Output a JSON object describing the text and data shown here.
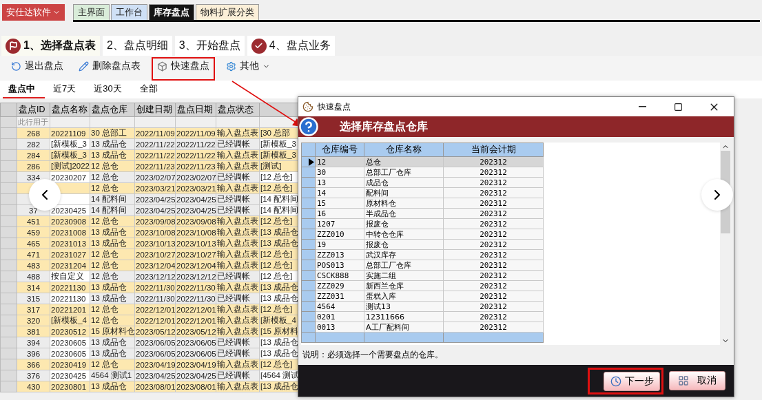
{
  "app_menu": {
    "label": "安仕达软件"
  },
  "main_tabs": [
    {
      "label": "主界面",
      "selected": false,
      "color": "#d9ecd9"
    },
    {
      "label": "工作台",
      "selected": false,
      "color": "#cfe0f5"
    },
    {
      "label": "库存盘点",
      "selected": true,
      "color": "#141414"
    },
    {
      "label": "物料扩展分类",
      "selected": false,
      "color": "#fbefd8"
    }
  ],
  "step_tabs": [
    {
      "label": "1、选择盘点表",
      "selected": true
    },
    {
      "label": "2、盘点明细",
      "selected": false
    },
    {
      "label": "3、开始盘点",
      "selected": false
    },
    {
      "label": "4、盘点业务",
      "selected": false
    }
  ],
  "toolbar": [
    {
      "label": "退出盘点",
      "marked": false
    },
    {
      "label": "删除盘点表",
      "marked": false
    },
    {
      "label": "快速盘点",
      "marked": true
    },
    {
      "label": "其他",
      "marked": false,
      "dropdown": true
    }
  ],
  "filter_tabs": [
    {
      "label": "盘点中",
      "selected": true
    },
    {
      "label": "近7天",
      "selected": false
    },
    {
      "label": "近30天",
      "selected": false
    },
    {
      "label": "全部",
      "selected": false
    }
  ],
  "table": {
    "columns": [
      "盘点ID",
      "盘点名称",
      "盘点仓库",
      "创建日期",
      "盘点日期",
      "盘点状态"
    ],
    "filter_row_text": "此行用于",
    "rows": [
      {
        "cells": [
          "268",
          "20221109",
          "30 总部工",
          "2022/11/09",
          "2022/11/09",
          "输入盘点表",
          "[30 总部"
        ],
        "highlighted": true
      },
      {
        "cells": [
          "282",
          "[新模板_3",
          "13 成品仓",
          "2022/11/22",
          "2022/11/22",
          "已经调帐",
          "[新模板_3"
        ],
        "highlighted": false
      },
      {
        "cells": [
          "284",
          "[新模板_3",
          "13 成品仓",
          "2022/11/22",
          "2022/11/22",
          "输入盘点表",
          "[新模板_3"
        ],
        "highlighted": true
      },
      {
        "cells": [
          "286",
          "[测试]2022",
          "12 总仓",
          "2022/11/23",
          "2022/11/23",
          "输入盘点表",
          "[测试]"
        ],
        "highlighted": true
      },
      {
        "cells": [
          "334",
          "20230207",
          "12 总仓",
          "2023/02/07",
          "2023/02/07",
          "已经调帐",
          "[12 总仓]"
        ],
        "highlighted": false
      },
      {
        "cells": [
          null,
          null,
          "12 总仓",
          "2023/03/21",
          "2023/03/21",
          "输入盘点表",
          "[12 总仓]"
        ],
        "highlighted": true
      },
      {
        "cells": [
          null,
          null,
          "14 配料间",
          "2023/04/25",
          "2023/04/25",
          "已经调帐",
          "[14 配料间"
        ],
        "highlighted": false
      },
      {
        "cells": [
          "37",
          "20230425",
          "14 配料间",
          "2023/04/25",
          "2023/04/25",
          "已经调帐",
          "[14 配料间"
        ],
        "highlighted": false
      },
      {
        "cells": [
          "451",
          "20230908",
          "12 总仓",
          "2023/09/08",
          "2023/09/08",
          "输入盘点表",
          "[12 总仓]"
        ],
        "highlighted": true
      },
      {
        "cells": [
          "459",
          "20231008",
          "13 成品仓",
          "2023/10/08",
          "2023/10/08",
          "输入盘点表",
          "[13 成品仓"
        ],
        "highlighted": true
      },
      {
        "cells": [
          "465",
          "20231013",
          "13 成品仓",
          "2023/10/13",
          "2023/10/13",
          "输入盘点表",
          "[13 成品仓"
        ],
        "highlighted": true
      },
      {
        "cells": [
          "471",
          "20231027",
          "12 总仓",
          "2023/10/27",
          "2023/10/27",
          "输入盘点表",
          "[12 总仓]"
        ],
        "highlighted": true
      },
      {
        "cells": [
          "483",
          "20231204",
          "12 总仓",
          "2023/12/04",
          "2023/12/04",
          "输入盘点表",
          "[12 总仓]"
        ],
        "highlighted": true
      },
      {
        "cells": [
          "488",
          "按自定义",
          "12 总仓",
          "2023/12/12",
          "2023/12/12",
          "已经调帐",
          "[12 总仓]"
        ],
        "highlighted": false
      },
      {
        "cells": [
          "314",
          "20221130",
          "13 成品仓",
          "2022/11/30",
          "2022/11/30",
          "输入盘点表",
          "[13 成品仓"
        ],
        "highlighted": true
      },
      {
        "cells": [
          "315",
          "20221130",
          "13 成品仓",
          "2022/11/30",
          "2022/11/30",
          "已经调帐",
          "[13 成品仓"
        ],
        "highlighted": false
      },
      {
        "cells": [
          "317",
          "20221201",
          "12 总仓",
          "2022/12/01",
          "2022/12/01",
          "输入盘点表",
          "[12 总仓]"
        ],
        "highlighted": true
      },
      {
        "cells": [
          "320",
          "[新模板_4",
          "12 总仓",
          "2022/12/01",
          "2022/12/01",
          "输入盘点表",
          "[新模板_4"
        ],
        "highlighted": true
      },
      {
        "cells": [
          "381",
          "20230512",
          "15 原材料仓",
          "2023/05/12",
          "2023/05/12",
          "输入盘点表",
          "[15 原材料"
        ],
        "highlighted": true
      },
      {
        "cells": [
          "394",
          "20230605",
          "13 成品仓",
          "2023/06/05",
          "2023/06/05",
          "已经调帐",
          "[13 成品仓"
        ],
        "highlighted": false
      },
      {
        "cells": [
          "396",
          "20230605",
          "13 成品仓",
          "2023/06/05",
          "2023/06/05",
          "已经调帐",
          "[13 成品仓"
        ],
        "highlighted": false
      },
      {
        "cells": [
          "366",
          "20230419",
          "12 总仓",
          "2023/04/19",
          "2023/04/19",
          "输入盘点表",
          "[12 总仓]"
        ],
        "highlighted": true
      },
      {
        "cells": [
          "376",
          "20230425",
          "4564 测试1",
          "2023/04/25",
          "2023/04/25",
          "已经调帐",
          "[4564 测试"
        ],
        "highlighted": false
      },
      {
        "cells": [
          "430",
          "20230801",
          "13 成品仓",
          "2023/08/01",
          "2023/08/01",
          "输入盘点表",
          "[13 成品仓"
        ],
        "highlighted": true
      }
    ]
  },
  "dialog": {
    "title": "快速盘点",
    "heading": "选择库存盘点仓库",
    "columns": [
      "仓库编号",
      "仓库名称",
      "当前会计期"
    ],
    "rows": [
      {
        "cells": [
          "12",
          "总仓",
          "202312"
        ],
        "selected": true
      },
      {
        "cells": [
          "30",
          "总部工厂仓库",
          "202312"
        ],
        "selected": false
      },
      {
        "cells": [
          "13",
          "成品仓",
          "202312"
        ],
        "selected": false
      },
      {
        "cells": [
          "14",
          "配料间",
          "202312"
        ],
        "selected": false
      },
      {
        "cells": [
          "15",
          "原材料仓",
          "202312"
        ],
        "selected": false
      },
      {
        "cells": [
          "16",
          "半成品仓",
          "202312"
        ],
        "selected": false
      },
      {
        "cells": [
          "1207",
          "报废仓",
          "202312"
        ],
        "selected": false
      },
      {
        "cells": [
          "ZZZ010",
          "中转仓仓库",
          "202312"
        ],
        "selected": false
      },
      {
        "cells": [
          "19",
          "报废仓",
          "202312"
        ],
        "selected": false
      },
      {
        "cells": [
          "ZZZ013",
          "武汉库存",
          "202312"
        ],
        "selected": false
      },
      {
        "cells": [
          "POS013",
          "总部工厂仓库",
          "202312"
        ],
        "selected": false
      },
      {
        "cells": [
          "CSCK888",
          "实施二组",
          "202312"
        ],
        "selected": false
      },
      {
        "cells": [
          "ZZZ029",
          "新西兰仓库",
          "202312"
        ],
        "selected": false
      },
      {
        "cells": [
          "ZZZ031",
          "蛋糕入库",
          "202312"
        ],
        "selected": false
      },
      {
        "cells": [
          "4564",
          "测试13",
          "202312"
        ],
        "selected": false
      },
      {
        "cells": [
          "0201",
          "12311666",
          "202312"
        ],
        "selected": false
      },
      {
        "cells": [
          "0013",
          "A工厂配料间",
          "202312"
        ],
        "selected": false
      }
    ],
    "note": "说明：必须选择一个需要盘点的仓库。",
    "buttons": [
      {
        "label": "下一步",
        "marked": true
      },
      {
        "label": "取消",
        "marked": false
      }
    ]
  }
}
